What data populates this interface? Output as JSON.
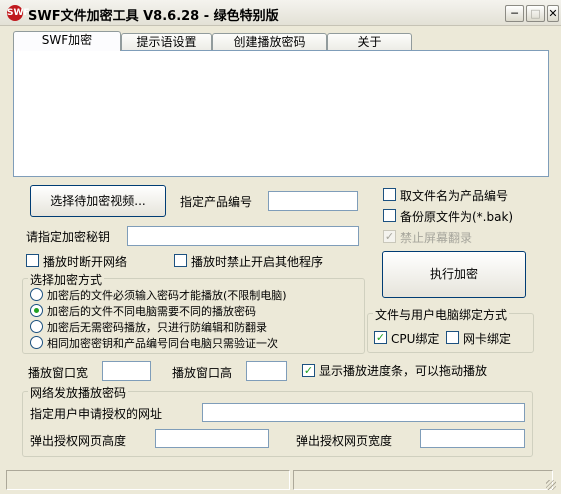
{
  "window": {
    "title": "SWF文件加密工具 V8.6.28 - 绿色特别版",
    "icon_text": "SWF"
  },
  "controls": {
    "minimize": "─",
    "maximize": "□",
    "close": "✕"
  },
  "tabs": [
    "SWF加密",
    "提示语设置",
    "创建播放密码",
    "关于"
  ],
  "main": {
    "select_video_button": "选择待加密视频...",
    "product_id_label": "指定产品编号",
    "product_id_value": "",
    "secret_label": "请指定加密秘钥",
    "secret_value": "",
    "opt_filename_as_id": "取文件名为产品编号",
    "opt_backup": "备份原文件为(*.bak)",
    "opt_no_screenshot": "禁止屏幕翻录",
    "opt_disconnect": "播放时断开网络",
    "opt_block_programs": "播放时禁止开启其他程序",
    "encrypt_button": "执行加密",
    "mode_group": {
      "legend": "选择加密方式",
      "options": [
        "加密后的文件必须输入密码才能播放(不限制电脑)",
        "加密后的文件不同电脑需要不同的播放密码",
        "加密后无需密码播放，只进行防编辑和防翻录",
        "相同加密密钥和产品编号同台电脑只需验证一次"
      ],
      "selected": 1
    },
    "bind_group": {
      "legend": "文件与用户电脑绑定方式",
      "cpu": "CPU绑定",
      "nic": "网卡绑定"
    },
    "win_width_label": "播放窗口宽",
    "win_height_label": "播放窗口高",
    "show_progress_label": "显示播放进度条，可以拖动播放",
    "net_group": {
      "legend": "网络发放播放密码",
      "url_label": "指定用户申请授权的网址",
      "popup_height_label": "弹出授权网页高度",
      "popup_width_label": "弹出授权网页宽度"
    }
  },
  "checks": {
    "check_mark": "✓"
  },
  "colors": {
    "accent_green": "#21a121",
    "border_blue": "#7f9db9",
    "bg": "#ece9d8"
  }
}
